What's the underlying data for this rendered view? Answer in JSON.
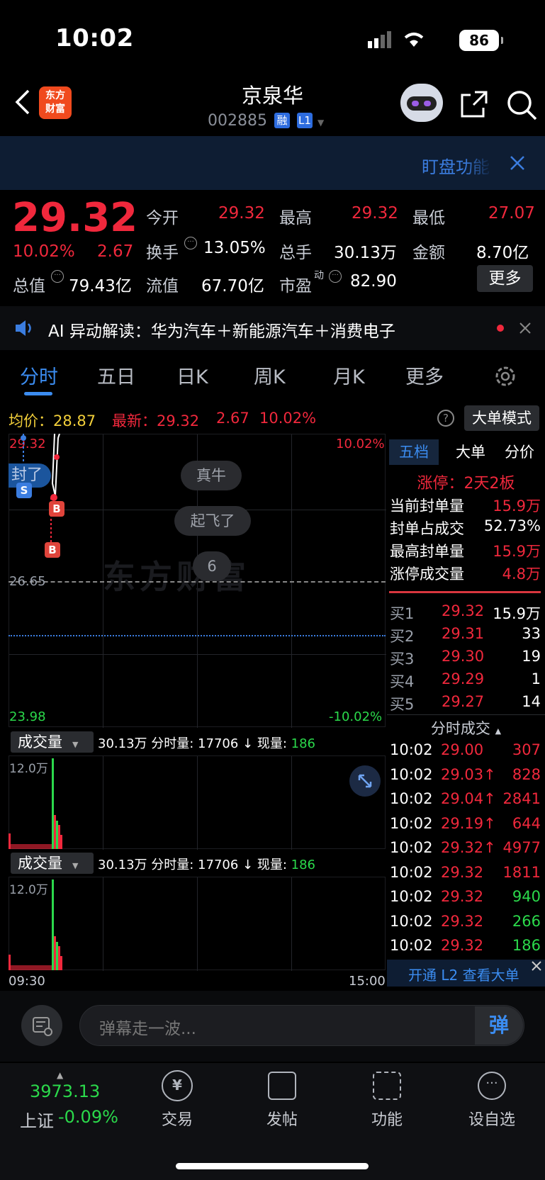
{
  "status": {
    "time": "10:02",
    "battery": "86"
  },
  "header": {
    "title": "京泉华",
    "code": "002885",
    "tag1": "融",
    "tag2": "L1",
    "logo_line1": "东方",
    "logo_line2": "财富"
  },
  "banner": {
    "text": "盯盘功能"
  },
  "quote": {
    "price": "29.32",
    "pct": "10.02%",
    "chg": "2.67",
    "r1": [
      {
        "l": "今开",
        "v": "29.32"
      },
      {
        "l": "最高",
        "v": "29.32"
      },
      {
        "l": "最低",
        "v": "27.07"
      }
    ],
    "r2": [
      {
        "l": "换手",
        "v": "13.05%"
      },
      {
        "l": "总手",
        "v": "30.13万"
      },
      {
        "l": "金额",
        "v": "8.70亿"
      }
    ],
    "r3": [
      {
        "l": "总值",
        "v": "79.43亿"
      },
      {
        "l": "流值",
        "v": "67.70亿"
      },
      {
        "l": "市盈",
        "sup": "动",
        "v": "82.90"
      }
    ],
    "more": "更多"
  },
  "ai": {
    "text": "AI 异动解读：华为汽车＋新能源汽车＋消费电子"
  },
  "tabs": [
    "分时",
    "五日",
    "日K",
    "周K",
    "月K",
    "更多"
  ],
  "chart": {
    "avg": "均价：28.87",
    "latest": "最新：29.32",
    "chg": "2.67",
    "pct": "10.02%",
    "mode": "大单模式",
    "high": "29.32",
    "low": "23.98",
    "mid": "26.65",
    "pcthi": "10.02%",
    "pctlo": "-10.02%",
    "danmu": [
      "真牛",
      "起飞了",
      "6"
    ],
    "sealed": "封了",
    "s": "S",
    "b": "B"
  },
  "vol": {
    "label": "成交量",
    "info": "30.13万 分时量: 17706 ↓ 现量:",
    "cur": "186",
    "max": "12.0万"
  },
  "axis": {
    "start": "09:30",
    "end": "15:00"
  },
  "panel": {
    "tabs": [
      "五档",
      "大单",
      "分价"
    ],
    "limit": "涨停：2天2板",
    "stats": [
      {
        "l": "当前封单量",
        "v": "15.9万"
      },
      {
        "l": "封单占成交",
        "v": "52.73%"
      },
      {
        "l": "最高封单量",
        "v": "15.9万"
      },
      {
        "l": "涨停成交量",
        "v": "4.8万"
      }
    ],
    "bids": [
      {
        "l": "买1",
        "p": "29.32",
        "q": "15.9万"
      },
      {
        "l": "买2",
        "p": "29.31",
        "q": "33"
      },
      {
        "l": "买3",
        "p": "29.30",
        "q": "19"
      },
      {
        "l": "买4",
        "p": "29.29",
        "q": "1"
      },
      {
        "l": "买5",
        "p": "29.27",
        "q": "14"
      }
    ],
    "ticks_title": "分时成交",
    "ticks": [
      {
        "t": "10:02",
        "p": "29.00",
        "q": "307",
        "c": "red"
      },
      {
        "t": "10:02",
        "p": "29.03↑",
        "q": "828",
        "c": "red"
      },
      {
        "t": "10:02",
        "p": "29.04↑",
        "q": "2841",
        "c": "red"
      },
      {
        "t": "10:02",
        "p": "29.19↑",
        "q": "644",
        "c": "red"
      },
      {
        "t": "10:02",
        "p": "29.32↑",
        "q": "4977",
        "c": "red"
      },
      {
        "t": "10:02",
        "p": "29.32",
        "q": "1811",
        "c": "red"
      },
      {
        "t": "10:02",
        "p": "29.32",
        "q": "940",
        "c": "green"
      },
      {
        "t": "10:02",
        "p": "29.32",
        "q": "266",
        "c": "green"
      },
      {
        "t": "10:02",
        "p": "29.32",
        "q": "186",
        "c": "green"
      }
    ],
    "l2": "开通 L2 查看大单"
  },
  "comment": {
    "placeholder": "弹幕走一波...",
    "btn": "弹"
  },
  "nav": {
    "index": "3973.13",
    "index_name": "上证",
    "index_chg": "-0.09%",
    "items": [
      "交易",
      "发帖",
      "功能",
      "设自选"
    ]
  }
}
